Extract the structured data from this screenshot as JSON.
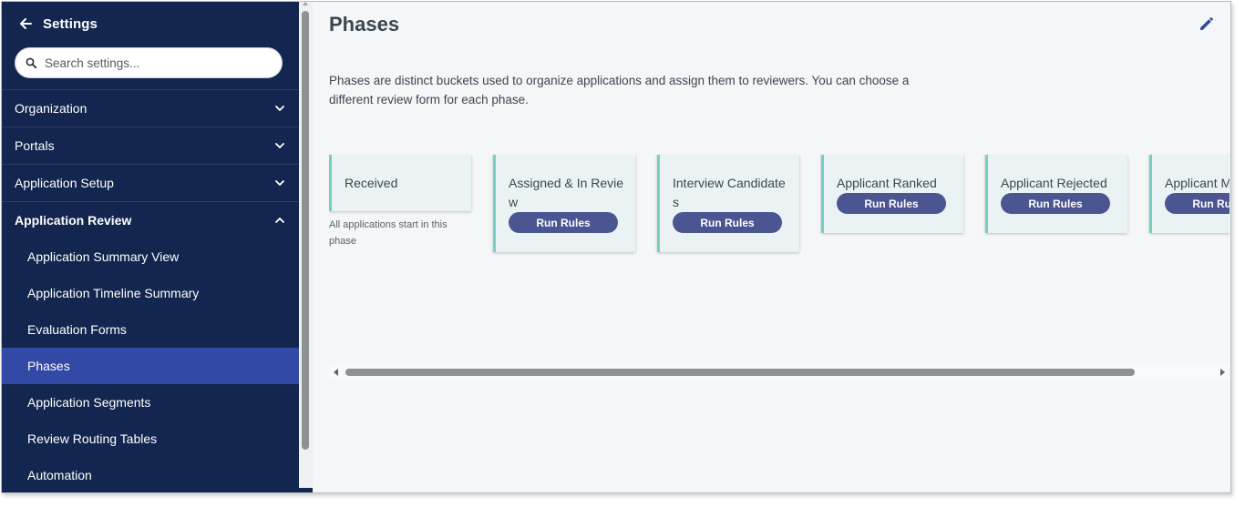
{
  "sidebar": {
    "title": "Settings",
    "search": {
      "placeholder": "Search settings...",
      "value": ""
    },
    "sections": [
      {
        "label": "Organization",
        "expanded": false
      },
      {
        "label": "Portals",
        "expanded": false
      },
      {
        "label": "Application Setup",
        "expanded": false
      },
      {
        "label": "Application Review",
        "expanded": true
      }
    ],
    "review_items": [
      {
        "label": "Application Summary View",
        "active": false
      },
      {
        "label": "Application Timeline Summary",
        "active": false
      },
      {
        "label": "Evaluation Forms",
        "active": false
      },
      {
        "label": "Phases",
        "active": true
      },
      {
        "label": "Application Segments",
        "active": false
      },
      {
        "label": "Review Routing Tables",
        "active": false
      },
      {
        "label": "Automation",
        "active": false
      }
    ]
  },
  "main": {
    "title": "Phases",
    "description": "Phases are distinct buckets used to organize applications and assign them to reviewers. You can choose a different review form for each phase.",
    "phases": [
      {
        "name": "Received",
        "note": "All applications start in this phase",
        "button": ""
      },
      {
        "name": "Assigned & In Review",
        "note": "",
        "button": "Run Rules"
      },
      {
        "name": "Interview Candidates",
        "note": "",
        "button": "Run Rules"
      },
      {
        "name": "Applicant Ranked",
        "note": "",
        "button": "Run Rules"
      },
      {
        "name": "Applicant Rejected",
        "note": "",
        "button": "Run Rules"
      },
      {
        "name": "Applicant M",
        "note": "",
        "button": "Run Rules"
      }
    ]
  },
  "colors": {
    "sidebar_bg": "#13264f",
    "active_item": "#3249a6",
    "card_bg": "#eaf2f3",
    "card_accent": "#74d0c3",
    "button_bg": "#4a5592",
    "edit_icon": "#2b4c9a"
  },
  "icons": {
    "back": "arrow-left-icon",
    "search": "search-icon",
    "section_collapsed": "chevron-down-icon",
    "section_expanded": "chevron-up-icon",
    "edit": "pencil-icon"
  }
}
